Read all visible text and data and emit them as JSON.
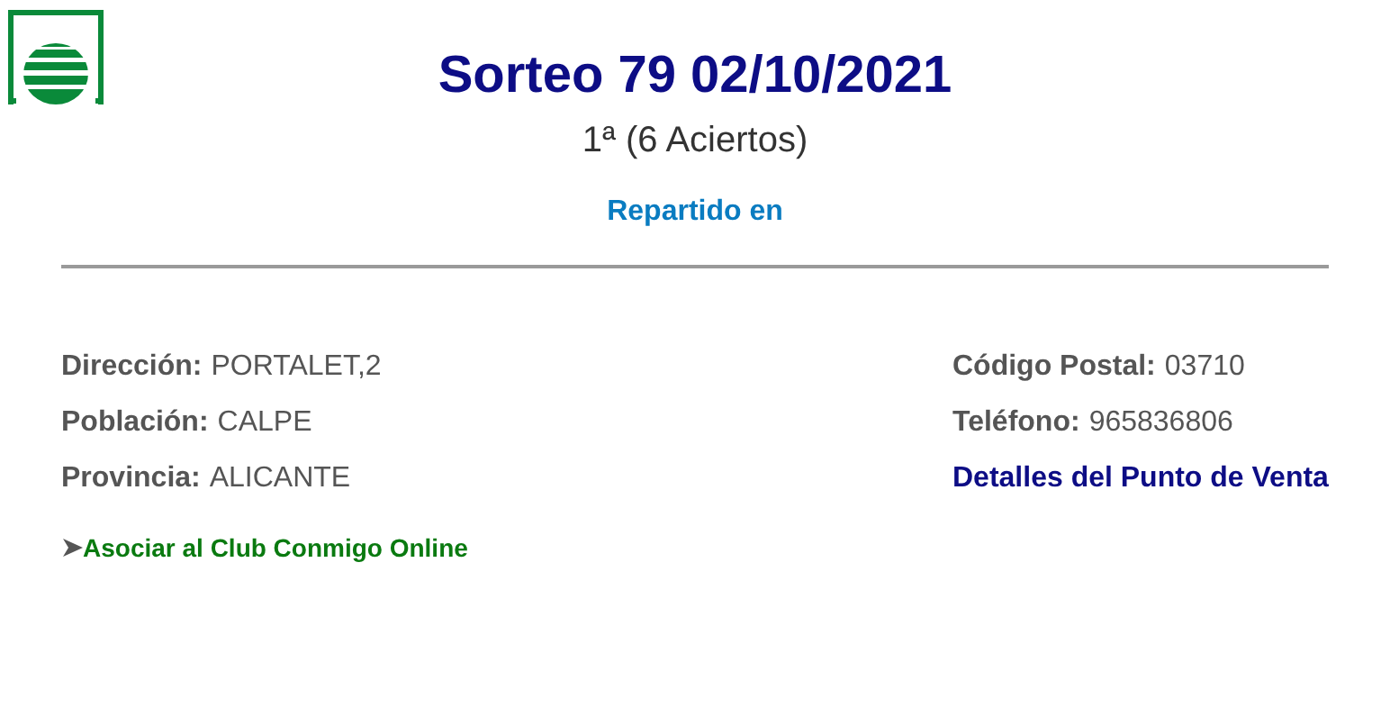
{
  "title": "Sorteo 79 02/10/2021",
  "subtitle": "1ª (6 Aciertos)",
  "section_heading": "Repartido en",
  "left_fields": [
    {
      "label": "Dirección:",
      "value": "PORTALET,2"
    },
    {
      "label": "Población:",
      "value": "CALPE"
    },
    {
      "label": "Provincia:",
      "value": "ALICANTE"
    }
  ],
  "right_fields": [
    {
      "label": "Código Postal:",
      "value": "03710"
    },
    {
      "label": "Teléfono:",
      "value": "965836806"
    }
  ],
  "details_link": "Detalles del Punto de Venta",
  "club_link": "Asociar al Club Conmigo Online"
}
